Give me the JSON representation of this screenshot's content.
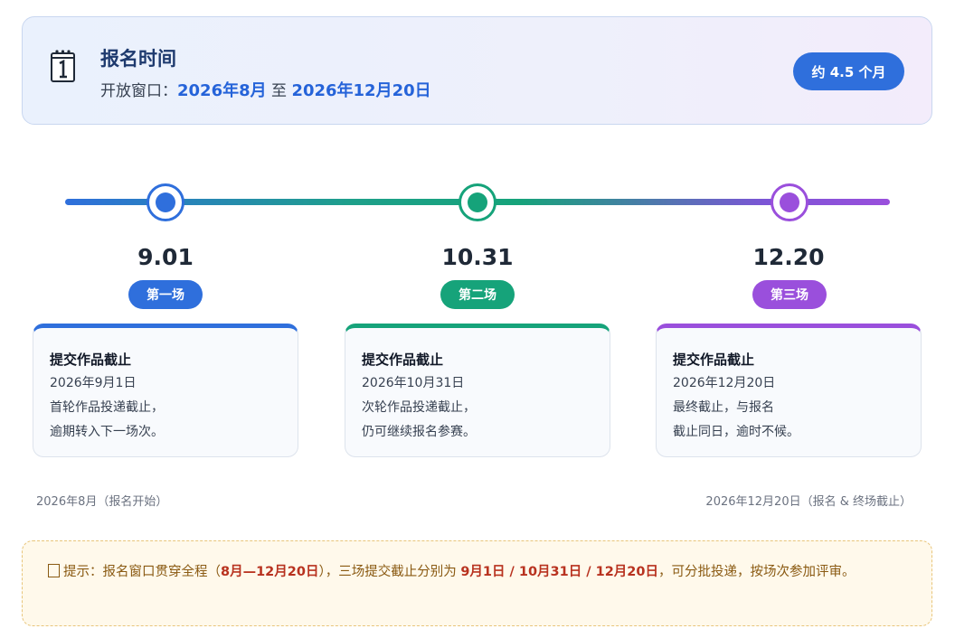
{
  "header": {
    "title": "报名时间",
    "window_label": "开放窗口：",
    "start": "2026年8月",
    "to": "至",
    "end": "2026年12月20日",
    "duration": "约 4.5 个月",
    "icon": "calendar-icon"
  },
  "timeline": {
    "colors": {
      "first": "#2f6fdc",
      "second": "#16a37a",
      "third": "#9a4fdc"
    },
    "rounds": [
      {
        "date": "9.01",
        "label": "第一场",
        "card_title": "提交作品截止",
        "card_date": "2026年9月1日",
        "card_line1": "首轮作品投递截止，",
        "card_line2": "逾期转入下一场次。"
      },
      {
        "date": "10.31",
        "label": "第二场",
        "card_title": "提交作品截止",
        "card_date": "2026年10月31日",
        "card_line1": "次轮作品投递截止，",
        "card_line2": "仍可继续报名参赛。"
      },
      {
        "date": "12.20",
        "label": "第三场",
        "card_title": "提交作品截止",
        "card_date": "2026年12月20日",
        "card_line1": "最终截止，与报名",
        "card_line2": "截止同日，逾时不候。"
      }
    ],
    "start_caption": "2026年8月（报名开始）",
    "end_caption": "2026年12月20日（报名 & 终场截止）"
  },
  "notice": {
    "icon": "notice-box-icon",
    "prefix": "提示：报名窗口贯穿全程（",
    "range": "8月—12月20日",
    "middle": "），三场提交截止分别为 ",
    "deadlines": "9月1日 / 10月31日 / 12月20日",
    "suffix": "，可分批投递，按场次参加评审。"
  }
}
